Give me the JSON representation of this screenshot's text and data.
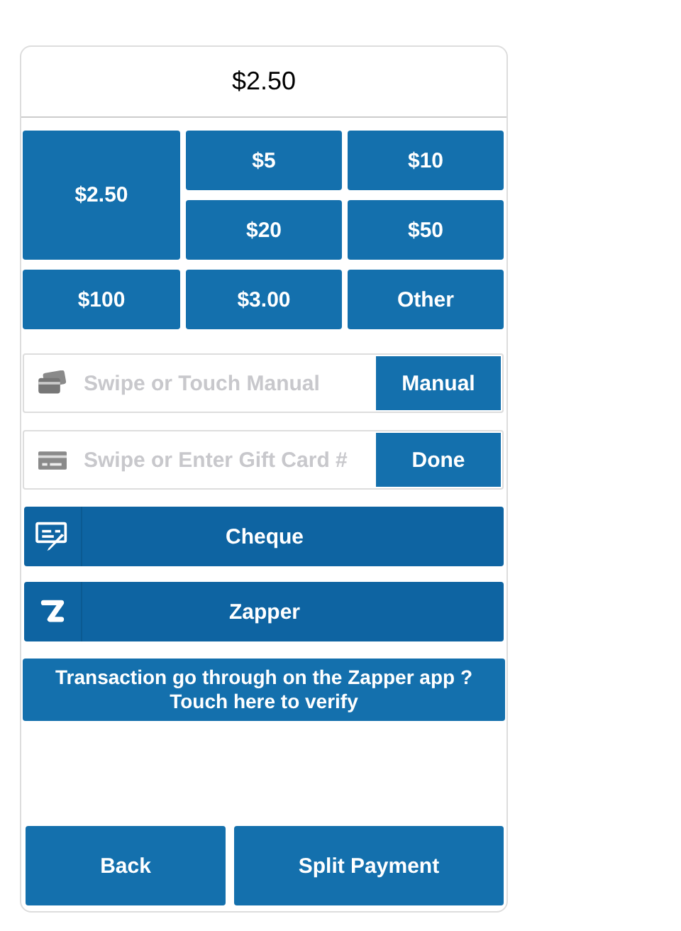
{
  "total": "$2.50",
  "amounts": [
    {
      "label": "$2.50",
      "kind": "large"
    },
    {
      "label": "$5",
      "kind": "normal"
    },
    {
      "label": "$10",
      "kind": "normal"
    },
    {
      "label": "$20",
      "kind": "normal"
    },
    {
      "label": "$50",
      "kind": "normal"
    },
    {
      "label": "$100",
      "kind": "normal"
    },
    {
      "label": "$3.00",
      "kind": "normal"
    },
    {
      "label": "Other",
      "kind": "normal"
    }
  ],
  "card_fields": [
    {
      "kind": "card",
      "placeholder": "Swipe or Touch Manual",
      "button": "Manual"
    },
    {
      "kind": "gift",
      "placeholder": "Swipe or Enter Gift Card #",
      "button": "Done"
    }
  ],
  "methods": [
    {
      "kind": "cheque",
      "label": "Cheque"
    },
    {
      "kind": "zapper",
      "label": "Zapper"
    }
  ],
  "verify": "Transaction go through on the Zapper app ?\nTouch here to verify",
  "footer_buttons": [
    "Back",
    "Split Payment"
  ]
}
